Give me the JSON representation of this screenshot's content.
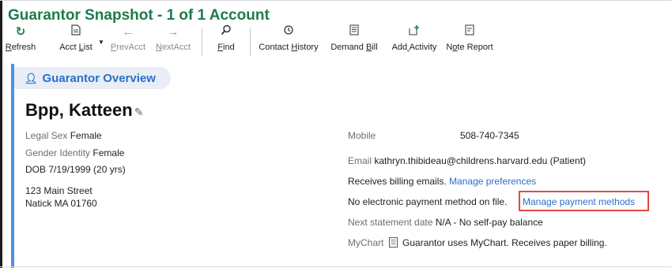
{
  "window": {
    "title": "Guarantor Snapshot - 1 of 1 Account"
  },
  "toolbar": {
    "refresh": {
      "label": "Refresh",
      "icon": "refresh-icon"
    },
    "acct_list": {
      "label": "Acct List",
      "icon": "document-icon"
    },
    "prev_acct": {
      "label": "PrevAcct",
      "icon": "arrow-left-icon"
    },
    "next_acct": {
      "label": "NextAcct",
      "icon": "arrow-right-icon"
    },
    "find": {
      "label": "Find",
      "icon": "search-icon"
    },
    "contact_history": {
      "label": "Contact History",
      "icon": "history-icon"
    },
    "demand_bill": {
      "label": "Demand Bill",
      "icon": "bill-icon"
    },
    "add_activity": {
      "label": "Add Activity",
      "icon": "add-activity-icon"
    },
    "note_report": {
      "label": "Note Report",
      "icon": "note-icon"
    }
  },
  "section": {
    "title": "Guarantor Overview",
    "icon": "person-icon"
  },
  "guarantor": {
    "name": "Bpp, Katteen",
    "legal_sex_label": "Legal Sex",
    "legal_sex": "Female",
    "gender_identity_label": "Gender Identity",
    "gender_identity": "Female",
    "dob": "DOB 7/19/1999 (20 yrs)",
    "address_line1": "123 Main Street",
    "address_line2": "Natick MA 01760"
  },
  "contact": {
    "mobile_label": "Mobile",
    "mobile": "508-740-7345",
    "email_label": "Email",
    "email": "kathryn.thibideau@childrens.harvard.edu (Patient)",
    "billing_emails": "Receives billing emails.",
    "manage_preferences": "Manage preferences",
    "no_payment": "No electronic payment method on file.",
    "manage_payment": "Manage payment methods",
    "next_statement_label": "Next statement date",
    "next_statement": "N/A - No self-pay balance",
    "mychart_label": "MyChart",
    "mychart_status": "Guarantor uses MyChart. Receives paper billing."
  },
  "colors": {
    "title": "#1f7a4c",
    "link": "#2a6fc9",
    "accent": "#4f90ec",
    "highlight": "#e04a3f"
  }
}
